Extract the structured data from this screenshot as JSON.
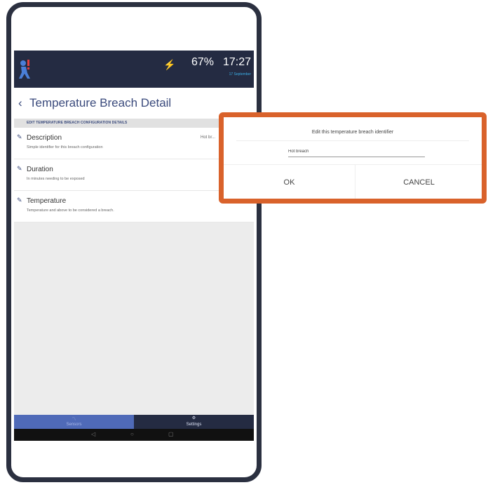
{
  "status_bar": {
    "battery_icon": "battery-charging-icon",
    "battery_glyph": "⚡",
    "battery_percent": "67%",
    "time": "17:27",
    "date": "17 September"
  },
  "header": {
    "back_glyph": "‹",
    "title": "Temperature Breach Detail"
  },
  "section": {
    "header": "EDIT TEMPERATURE BREACH CONFIGURATION DETAILS"
  },
  "rows": [
    {
      "title": "Description",
      "subtitle": "Simple identifier for this breach configuration",
      "value": "Hot br..."
    },
    {
      "title": "Duration",
      "subtitle": "In minutes needing to be exposed",
      "value": ""
    },
    {
      "title": "Temperature",
      "subtitle": "Temperature and above to be considered a breach.",
      "value": ""
    }
  ],
  "bottom_nav": [
    {
      "label": "Sensors",
      "icon": "chart-icon",
      "glyph": "〽"
    },
    {
      "label": "Settings",
      "icon": "gear-icon",
      "glyph": "⚙"
    }
  ],
  "system_nav": {
    "back": "◁",
    "home": "○",
    "recents": "▢"
  },
  "dialog": {
    "title": "Edit this temperature breach identifier",
    "input_value": "Hot breach",
    "ok_label": "OK",
    "cancel_label": "CANCEL"
  },
  "colors": {
    "status_bar": "#242b42",
    "accent": "#3a4a7c",
    "highlight": "#d9622b",
    "nav_selected": "#4f6ab8"
  }
}
